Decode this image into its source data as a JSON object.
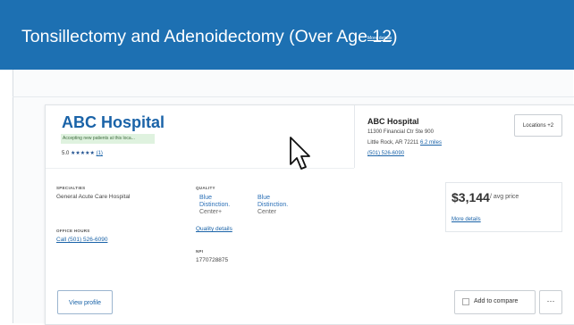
{
  "header": {
    "title": "Tonsillectomy and Adenoidectomy (Over Age 12)",
    "more_details_link": "More details"
  },
  "hospital": {
    "name": "ABC Hospital",
    "accepting_badge": "Accepting new patients at this loca...",
    "rating_value": "5.0",
    "stars": "★★★★★",
    "review_count": "(1)"
  },
  "address": {
    "name": "ABC Hospital",
    "line1": "11300 Financial Ctr Ste 900",
    "city_state_zip": "Little Rock, AR 72211",
    "distance": "6.2 miles",
    "phone": "(501) 526-6090"
  },
  "locations_button": "Locations +2",
  "specialties": {
    "label": "SPECIALTIES",
    "value": "General Acute Care Hospital"
  },
  "office_hours": {
    "label": "OFFICE HOURS",
    "call_link": "Call (501) 526-6090"
  },
  "quality": {
    "label": "QUALITY",
    "badges": [
      {
        "line1": "Blue",
        "line2": "Distinction.",
        "line3": "Center+"
      },
      {
        "line1": "Blue",
        "line2": "Distinction.",
        "line3": "Center"
      }
    ],
    "details_link": "Quality details"
  },
  "npi": {
    "label": "NPI",
    "value": "1770728875"
  },
  "price": {
    "amount": "$3,144",
    "unit": "/ avg price",
    "more_details": "More details"
  },
  "actions": {
    "view_profile": "View profile",
    "add_to_compare": "Add to compare",
    "more": "⋯"
  },
  "colors": {
    "header_blue": "#1d70b2",
    "link_blue": "#1a63a8",
    "badge_green_bg": "#dff2df"
  }
}
